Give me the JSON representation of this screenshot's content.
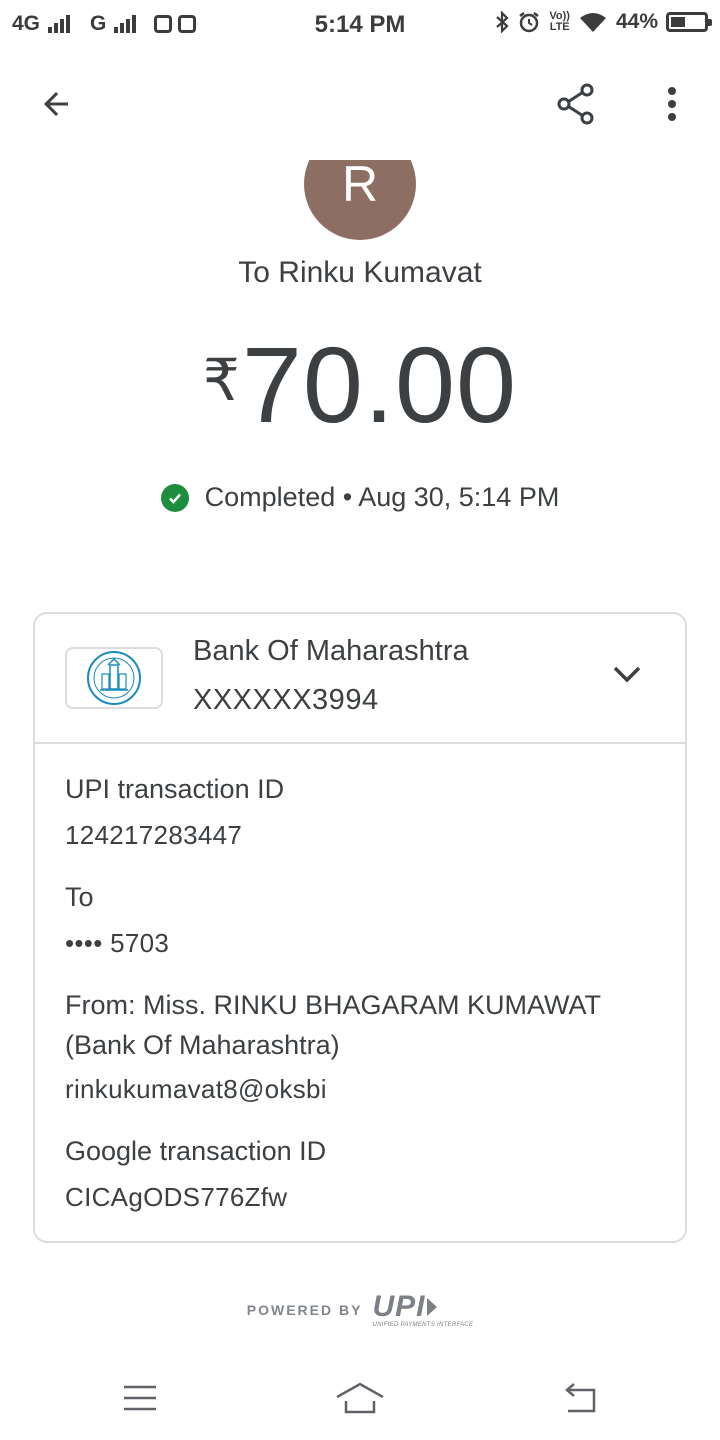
{
  "status_bar": {
    "network_1": "4G",
    "network_2": "G",
    "time": "5:14 PM",
    "volte_top": "Vo))",
    "volte_bottom": "LTE",
    "battery_percent": "44%",
    "battery_level": 0.44
  },
  "payee": {
    "initial": "R",
    "to_label": "To Rinku Kumavat",
    "avatar_color": "#8d6e63"
  },
  "payment": {
    "currency_symbol": "₹",
    "amount": "70.00",
    "status_text": "Completed • Aug 30, 5:14 PM",
    "status_color": "#1e8e3e"
  },
  "bank": {
    "name": "Bank Of Maharashtra",
    "account": "XXXXXX3994"
  },
  "details": {
    "upi_id_label": "UPI transaction ID",
    "upi_id_value": "124217283447",
    "to_label": "To",
    "to_value": "•••• 5703",
    "from_line1": "From: Miss. RINKU BHAGARAM KUMAWAT",
    "from_line2": "(Bank Of Maharashtra)",
    "from_vpa": "rinkukumavat8@oksbi",
    "google_id_label": "Google transaction ID",
    "google_id_value": "CICAgODS776Zfw"
  },
  "footer": {
    "powered_by": "POWERED BY",
    "upi_mark": "UPI",
    "upi_sub": "UNIFIED PAYMENTS INTERFACE"
  },
  "icons": {
    "back": "arrow-back-icon",
    "share": "share-icon",
    "more": "more-vert-icon",
    "expand": "chevron-down-icon",
    "check": "check-circle-icon",
    "nav_menu": "menu-icon",
    "nav_home": "home-icon",
    "nav_back": "back-icon"
  }
}
